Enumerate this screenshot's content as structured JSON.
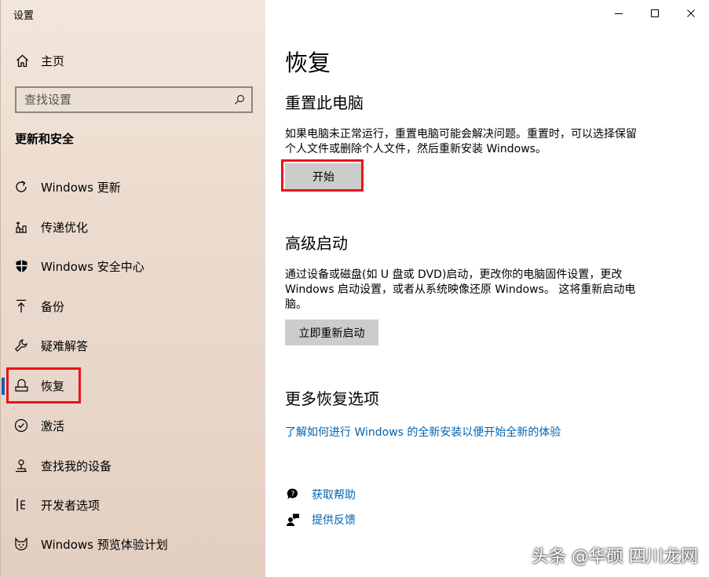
{
  "window": {
    "title": "设置"
  },
  "sidebar": {
    "home_label": "主页",
    "search_placeholder": "查找设置",
    "section_title": "更新和安全",
    "items": [
      {
        "label": "Windows 更新",
        "icon": "refresh-icon"
      },
      {
        "label": "传递优化",
        "icon": "delivery-optimization-icon"
      },
      {
        "label": "Windows 安全中心",
        "icon": "shield-icon"
      },
      {
        "label": "备份",
        "icon": "backup-arrow-icon"
      },
      {
        "label": "疑难解答",
        "icon": "wrench-icon"
      },
      {
        "label": "恢复",
        "icon": "recovery-icon",
        "active": true
      },
      {
        "label": "激活",
        "icon": "check-circle-icon"
      },
      {
        "label": "查找我的设备",
        "icon": "find-device-icon"
      },
      {
        "label": "开发者选项",
        "icon": "developer-icon"
      },
      {
        "label": "Windows 预览体验计划",
        "icon": "insider-cat-icon"
      }
    ]
  },
  "main": {
    "title": "恢复",
    "reset": {
      "heading": "重置此电脑",
      "line1": "如果电脑未正常运行，重置电脑可能会解决问题。重置时，可以选择保留",
      "line2": "个人文件或删除个人文件，然后重新安装 Windows。",
      "button": "开始"
    },
    "advanced": {
      "heading": "高级启动",
      "line1": "通过设备或磁盘(如 U 盘或 DVD)启动，更改你的电脑固件设置，更改",
      "line2": "Windows 启动设置，或者从系统映像还原 Windows。  这将重新启动电",
      "line3": "脑。",
      "button": "立即重新启动"
    },
    "more": {
      "heading": "更多恢复选项",
      "link": "了解如何进行 Windows 的全新安装以便开始全新的体验"
    },
    "help": {
      "get_help": "获取帮助",
      "feedback": "提供反馈"
    }
  },
  "watermark": "头条 @华硕 四川龙网",
  "colors": {
    "accent": "#0063b1",
    "highlight": "#e8141b",
    "button_bg": "#cccccc"
  }
}
